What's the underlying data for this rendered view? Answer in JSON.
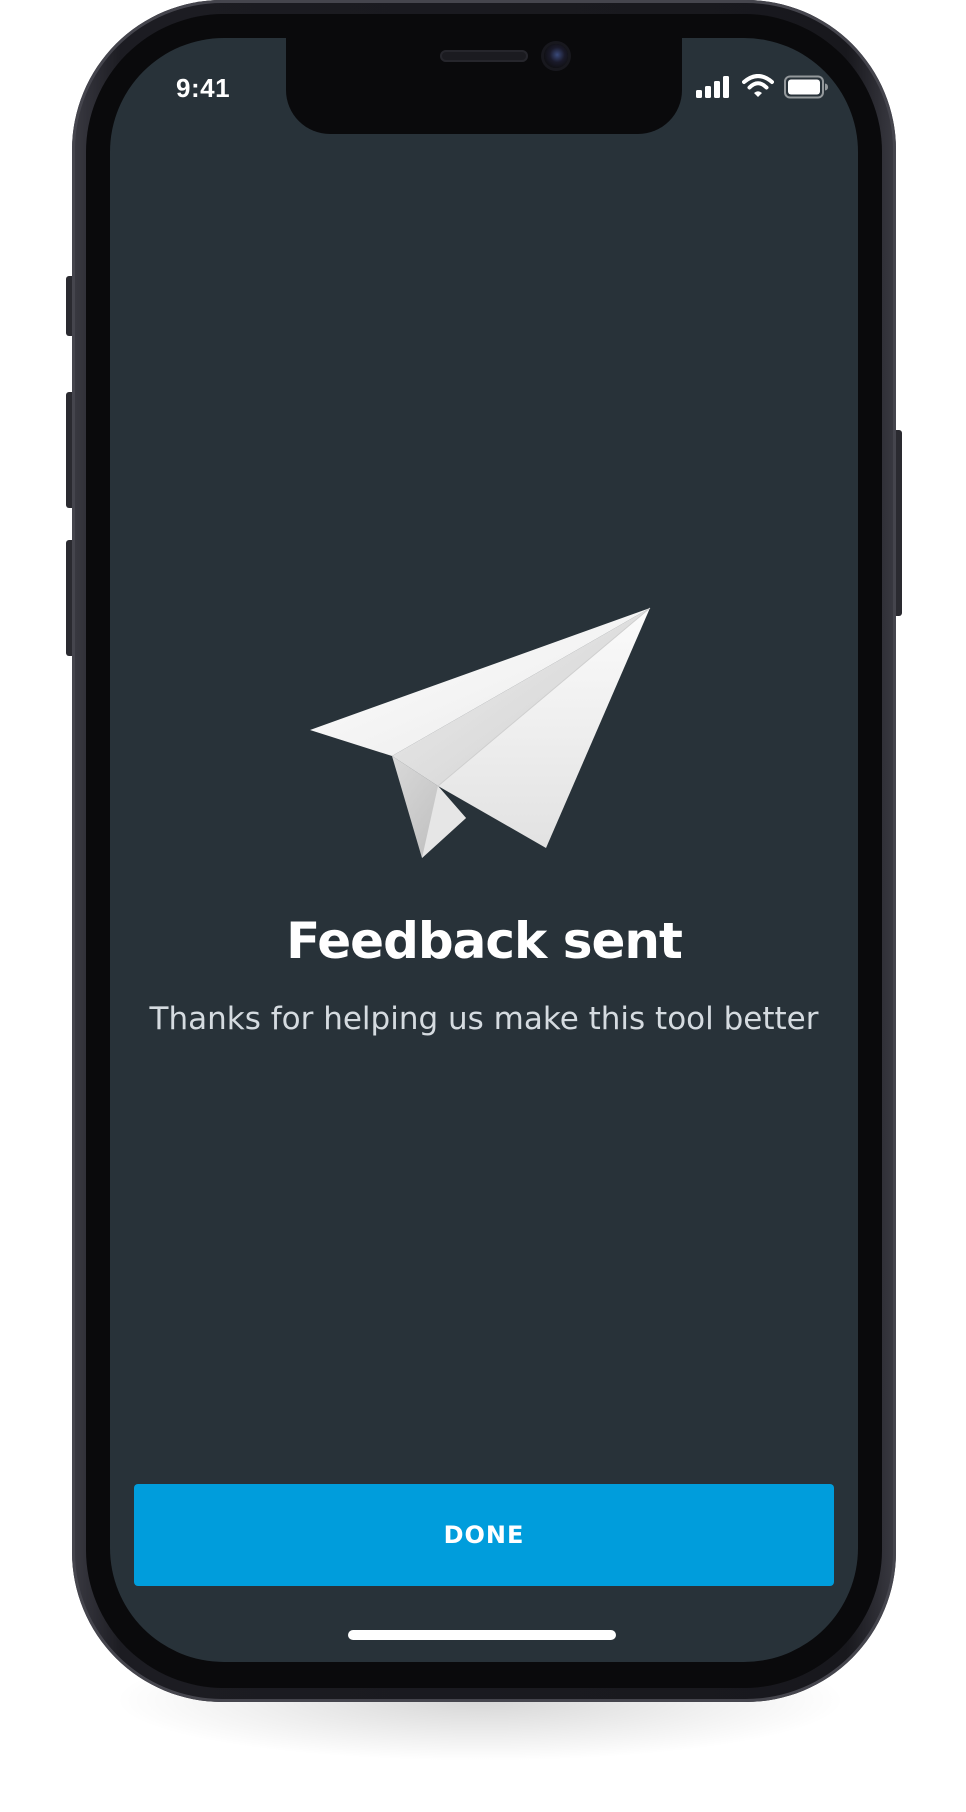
{
  "status_bar": {
    "time": "9:41",
    "icons": [
      "signal-icon",
      "wifi-icon",
      "battery-icon"
    ]
  },
  "illustration": {
    "icon": "paper-plane-icon"
  },
  "confirmation": {
    "title": "Feedback sent",
    "subtitle": "Thanks for helping us make this tool better"
  },
  "actions": {
    "done_label": "DONE"
  },
  "colors": {
    "screen_background": "#283239",
    "accent": "#009ddc",
    "text_primary": "#ffffff",
    "text_secondary": "#d5dbe0"
  }
}
